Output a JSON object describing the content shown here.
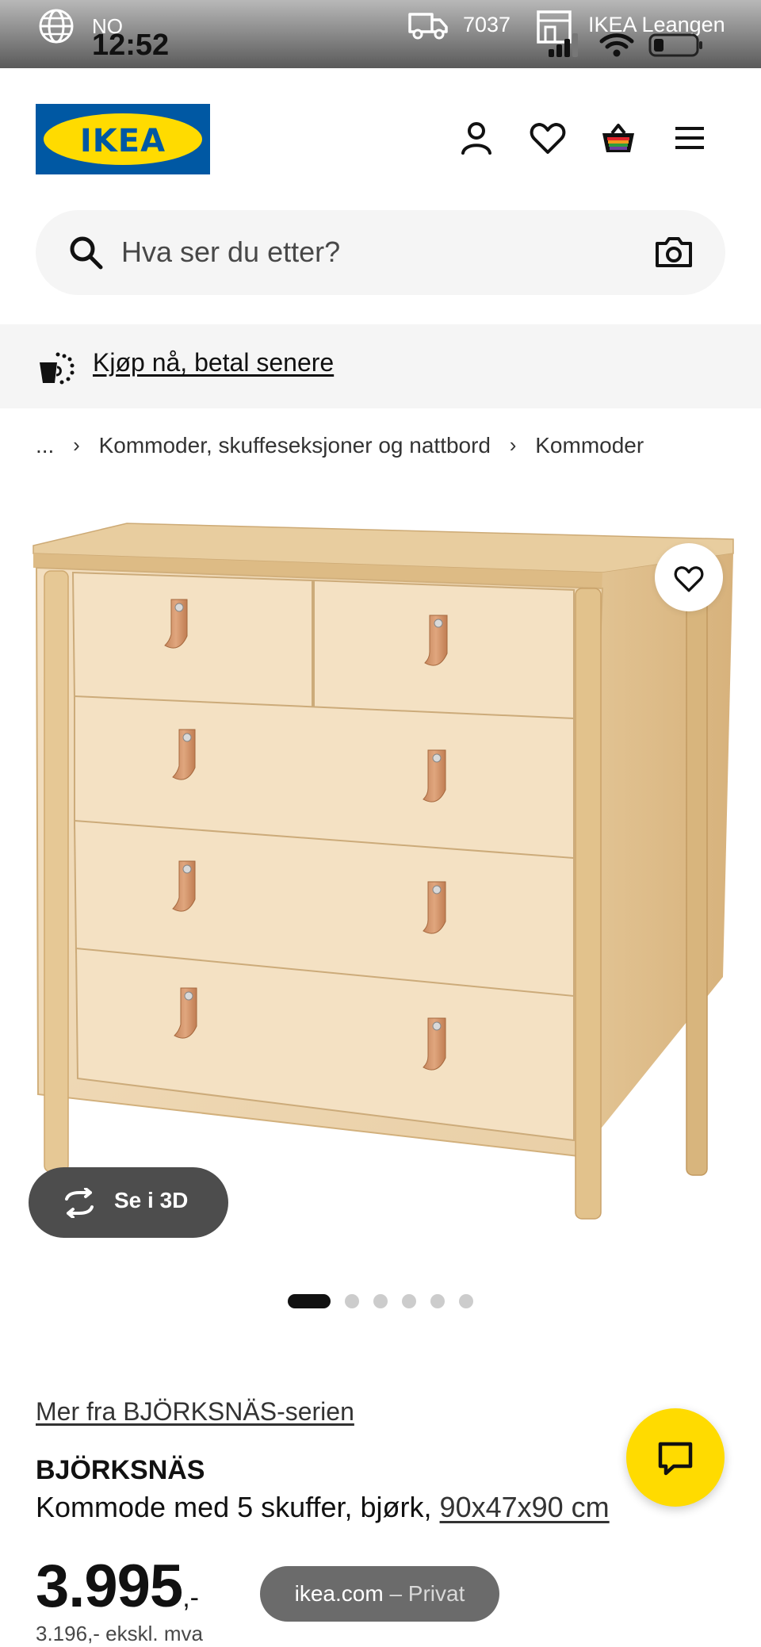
{
  "status_bar": {
    "carrier": "NO",
    "time": "12:52",
    "postcode": "7037",
    "store": "IKEA Leangen"
  },
  "header": {
    "logo_text": "IKEA",
    "icons": [
      "account-icon",
      "heart-icon",
      "cart-icon",
      "menu-icon"
    ]
  },
  "search": {
    "placeholder": "Hva ser du etter?"
  },
  "promo": {
    "label": "Kjøp nå, betal senere"
  },
  "breadcrumb": {
    "items": [
      "...",
      "Kommoder, skuffeseksjoner og nattbord",
      "Kommoder"
    ]
  },
  "gallery": {
    "see_3d_label": "Se i 3D",
    "image_count": 6,
    "active_index": 0
  },
  "product": {
    "series_link": "Mer fra BJÖRKSNÄS-serien",
    "name": "BJÖRKSNÄS",
    "description": "Kommode med 5 skuffer, bjørk, ",
    "dimensions": "90x47x90 cm",
    "price_main": "3.995",
    "price_suffix": ",-",
    "price_ex_vat": "3.196,- ekskl. mva"
  },
  "browser": {
    "domain": "ikea.com",
    "mode": " – Privat"
  },
  "colors": {
    "ikea_blue": "#0058a3",
    "ikea_yellow": "#ffdb00"
  }
}
